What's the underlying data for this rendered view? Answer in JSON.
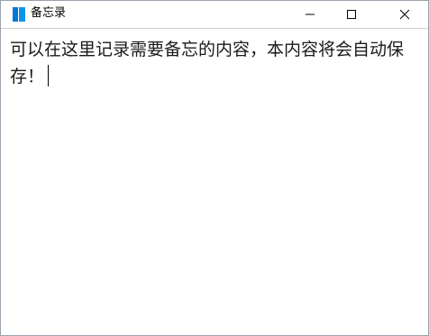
{
  "window": {
    "title": "备忘录",
    "app_icon": "memo-book-icon",
    "controls": {
      "minimize_icon": "minimize-icon",
      "maximize_icon": "maximize-icon",
      "close_icon": "close-icon"
    }
  },
  "editor": {
    "text": "可以在这里记录需要备忘的内容，本内容将会自动保存！"
  },
  "colors": {
    "app_icon_accent": "#0078d7",
    "text": "#1a1a1a",
    "border": "#9aa3ad"
  }
}
